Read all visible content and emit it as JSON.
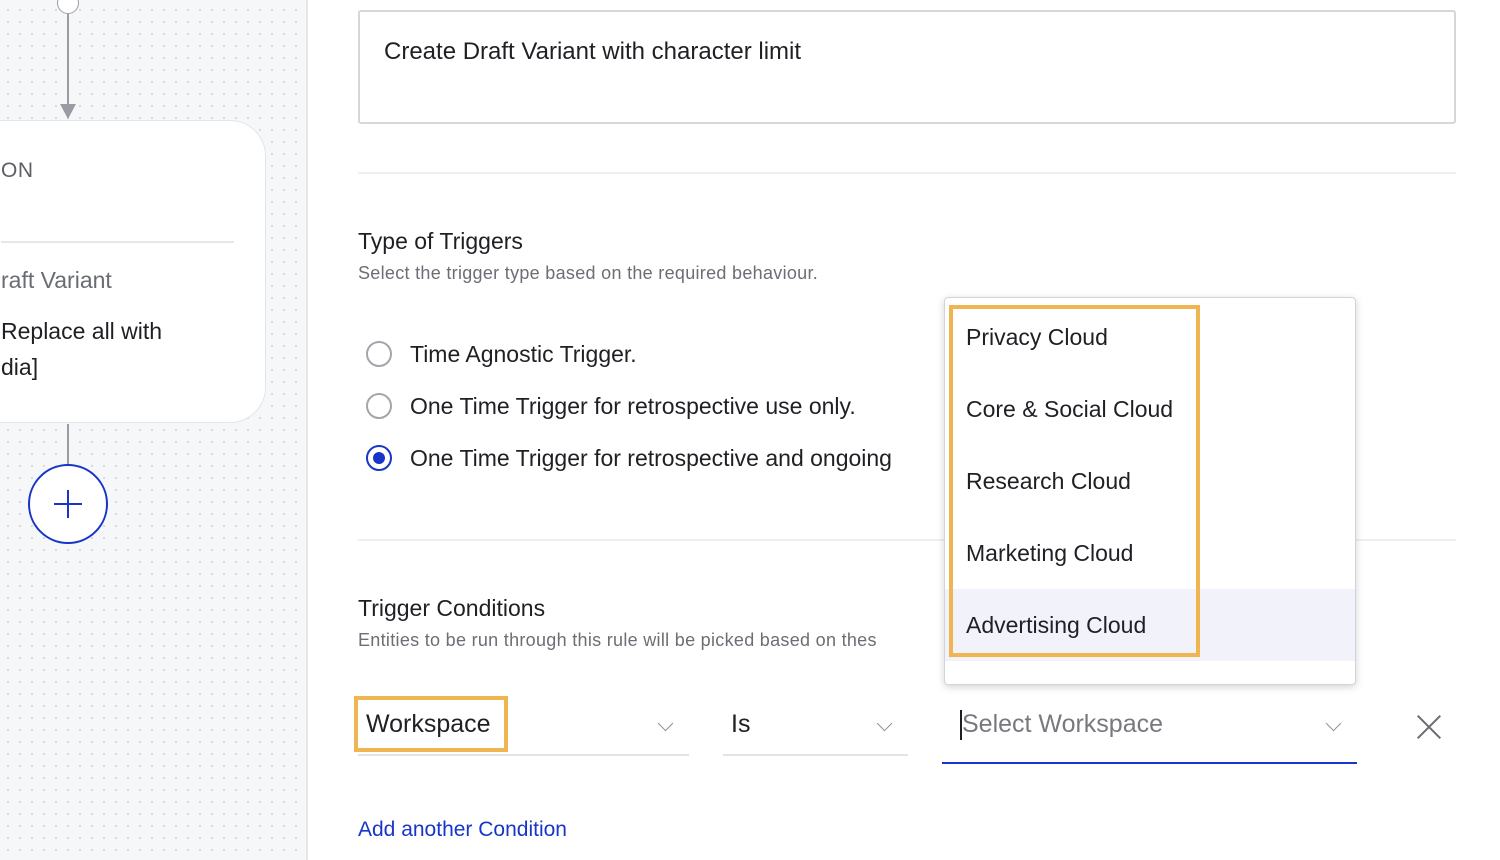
{
  "canvas": {
    "card": {
      "heading": "ON",
      "subtitle": "raft Variant",
      "body_line1": "Replace all with",
      "body_line2": "dia]"
    }
  },
  "form": {
    "rule_name": "Create Draft Variant with character limit",
    "trigger_type": {
      "title": "Type of Triggers",
      "description": "Select the trigger type based on the required behaviour.",
      "options": [
        {
          "label": "Time Agnostic Trigger.",
          "selected": false
        },
        {
          "label": "One Time Trigger for retrospective use only.",
          "selected": false
        },
        {
          "label": "One Time Trigger for retrospective and ongoing",
          "selected": true
        }
      ]
    },
    "trigger_conditions": {
      "title": "Trigger Conditions",
      "description": "Entities to be run through this rule will be picked based on thes",
      "condition": {
        "field": "Workspace",
        "operator": "Is",
        "value_placeholder": "Select Workspace"
      },
      "add_condition_label": "Add another Condition"
    },
    "workspace_dropdown": {
      "options": [
        "Privacy Cloud",
        "Core & Social Cloud",
        "Research Cloud",
        "Marketing Cloud",
        "Advertising Cloud"
      ],
      "hovered_index": 4
    }
  },
  "colors": {
    "accent": "#1736c9",
    "highlight": "#f0b553",
    "hover": "#f1f2fa"
  }
}
